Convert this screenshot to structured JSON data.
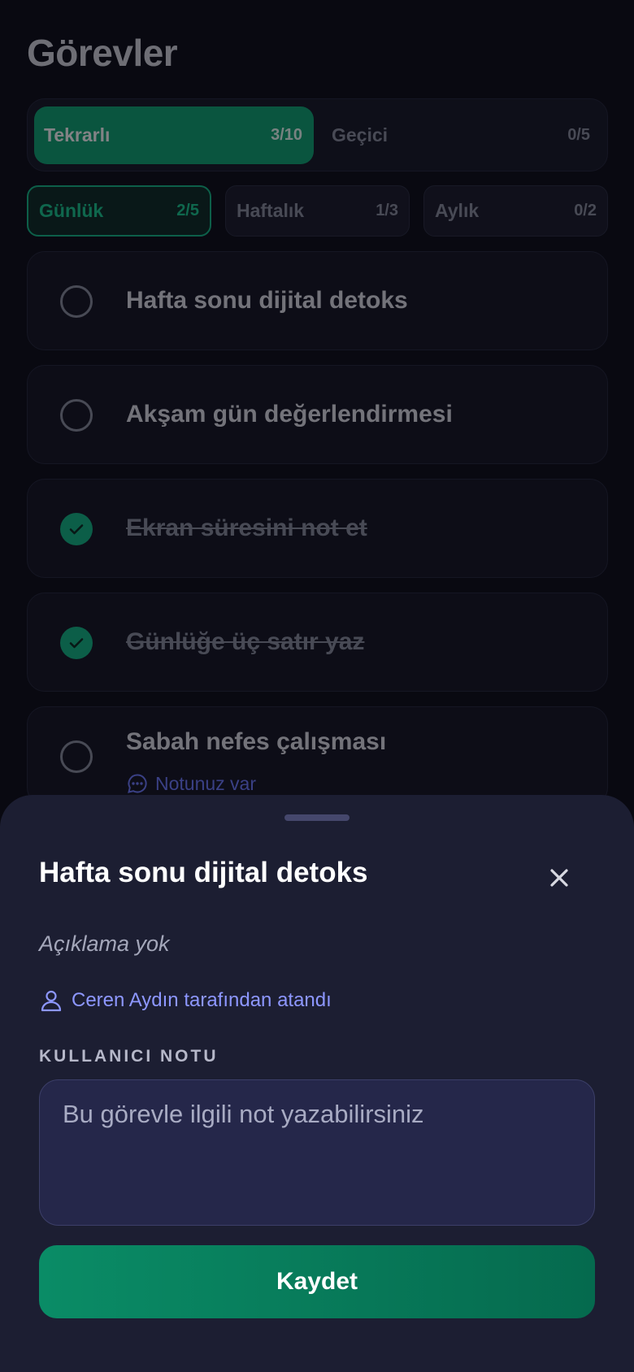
{
  "header": {
    "title": "Görevler"
  },
  "type_tabs": [
    {
      "label": "Tekrarlı",
      "count": "3/10",
      "active": true
    },
    {
      "label": "Geçici",
      "count": "0/5",
      "active": false
    }
  ],
  "period_tabs": [
    {
      "label": "Günlük",
      "count": "2/5",
      "active": true
    },
    {
      "label": "Haftalık",
      "count": "1/3",
      "active": false
    },
    {
      "label": "Aylık",
      "count": "0/2",
      "active": false
    }
  ],
  "tasks": [
    {
      "title": "Hafta sonu dijital detoks",
      "done": false
    },
    {
      "title": "Akşam gün değerlendirmesi",
      "done": false
    },
    {
      "title": "Ekran süresini not et",
      "done": true
    },
    {
      "title": "Günlüğe üç satır yaz",
      "done": true
    },
    {
      "title": "Sabah nefes çalışması",
      "done": false,
      "note": "Notunuz var"
    }
  ],
  "sheet": {
    "title": "Hafta sonu dijital detoks",
    "description": "Açıklama yok",
    "assigned_by": "Ceren Aydın tarafından atandı",
    "note_label": "KULLANICI NOTU",
    "note_placeholder": "Bu görevle ilgili not yazabilirsiniz",
    "note_value": "",
    "save_label": "Kaydet"
  },
  "colors": {
    "accent": "#0ea573",
    "link": "#8d97ff",
    "background": "#0c0d17",
    "sheet": "#1c1e32"
  }
}
